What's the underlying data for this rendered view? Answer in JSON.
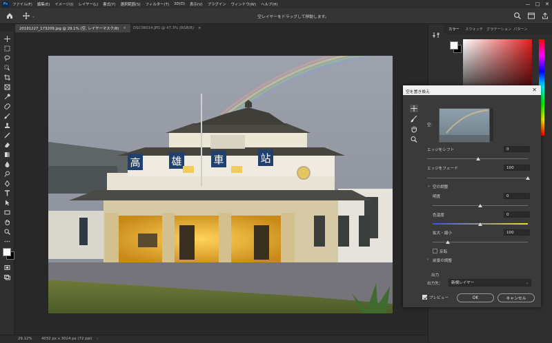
{
  "app": {
    "icon_label": "Ps"
  },
  "menu": [
    "ファイル(F)",
    "編集(E)",
    "イメージ(I)",
    "レイヤー(L)",
    "書式(Y)",
    "選択範囲(S)",
    "フィルター(T)",
    "3D(D)",
    "表示(V)",
    "プラグイン",
    "ウィンドウ(W)",
    "ヘルプ(H)"
  ],
  "window_controls": [
    "—",
    "□",
    "✕"
  ],
  "options_bar": {
    "hint": "空レイヤーをドラッグして移動します。"
  },
  "tabs": [
    {
      "label": "20191227_173209.jpg @ 29.1% (空, レイヤーマスク/8)",
      "close": "×"
    },
    {
      "label": "DSC08014.JPG @ 47.3% (RGB/8)",
      "close": "×"
    }
  ],
  "status": {
    "zoom": "29.12%",
    "doc_info": "4032 px x 3024 px (72 ppi)"
  },
  "panel": {
    "tabs": [
      "カラー",
      "スウォッチ",
      "グラデーション",
      "パターン"
    ]
  },
  "colors": {
    "accent": "#31a8ff",
    "picker_hue": "#e02020",
    "dialog_bg": "#3a3a3a",
    "color_temp_start": "#3a4cff",
    "color_temp_end": "#f0e020"
  },
  "photo": {
    "sign_chars": [
      "高",
      "雄",
      "車",
      "站"
    ]
  },
  "dialog": {
    "title": "空を置き換え",
    "close": "✕",
    "sky_label": "空:",
    "shift_edge": {
      "label": "エッジをシフト",
      "value": "0",
      "level": 0.5
    },
    "fade_edge": {
      "label": "エッジをフェード",
      "value": "100",
      "level": 1.0
    },
    "sky_adjust_header": "空の調整",
    "brightness": {
      "label": "明度",
      "value": "0",
      "level": 0.5
    },
    "temperature": {
      "label": "色温度",
      "value": "0",
      "level": 0.5
    },
    "scale": {
      "label": "拡大・縮小",
      "value": "100",
      "level": 0.2
    },
    "flip_label": "反転",
    "foreground_header": "前景の調整",
    "output_header": "出力",
    "output_to_label": "出力先：",
    "output_to_value": "新規レイヤー",
    "preview_label": "プレビュー",
    "ok": "OK",
    "cancel": "キャンセル"
  }
}
